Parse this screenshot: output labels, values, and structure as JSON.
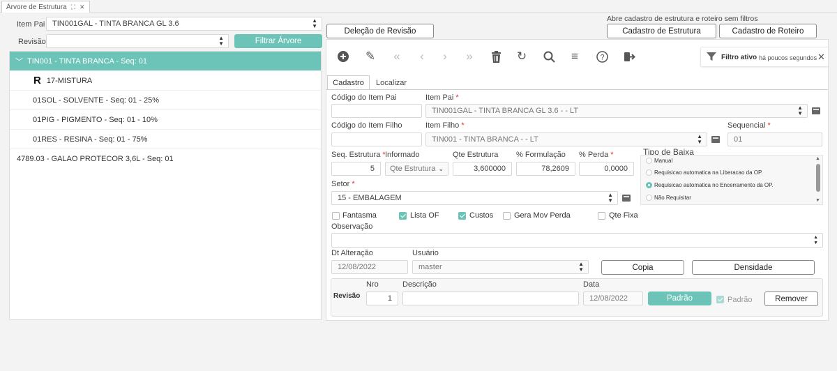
{
  "window": {
    "tab_title": "Árvore de Estrutura"
  },
  "left": {
    "item_pai_label": "Item Pai",
    "item_pai_value": "TIN001GAL - TINTA BRANCA GL 3.6",
    "revisao_label": "Revisão",
    "revisao_value": "",
    "filter_button": "Filtrar Árvore",
    "tree": [
      {
        "label": "TIN001 - TINTA BRANCA - Seq: 01"
      },
      {
        "label": "17-MISTURA"
      },
      {
        "label": "01SOL - SOLVENTE - Seq: 01 - 25%"
      },
      {
        "label": "01PIG - PIGMENTO - Seq: 01 - 10%"
      },
      {
        "label": "01RES - RESINA - Seq: 01 - 75%"
      },
      {
        "label": "4789.03 - GALAO PROTECOR 3,6L - Seq: 01"
      }
    ]
  },
  "top_right": {
    "delete_revision": "Deleção de Revisão",
    "hint": "Abre cadastro de estrutura e roteiro sem filtros",
    "cad_estrutura": "Cadastro de Estrutura",
    "cad_roteiro": "Cadastro de Roteiro"
  },
  "filter_badge": {
    "label": "Filtro ativo",
    "time": "há poucos segundos"
  },
  "form_tabs": [
    "Cadastro",
    "Localizar"
  ],
  "form": {
    "cod_item_pai_label": "Código do Item Pai",
    "cod_item_pai": "",
    "item_pai_label": "Item Pai",
    "item_pai": "TIN001GAL - TINTA BRANCA GL 3.6 -  - LT",
    "cod_item_filho_label": "Código do Item Filho",
    "cod_item_filho": "",
    "item_filho_label": "Item Filho",
    "item_filho": "TIN001 - TINTA BRANCA -  - LT",
    "sequencial_label": "Sequencial",
    "sequencial": "01",
    "seq_estrutura_label": "Seq. Estrutura",
    "seq_estrutura": "5",
    "informado_label": "Informado",
    "informado": "Qte Estrutura",
    "qte_estrutura_label": "Qte Estrutura",
    "qte_estrutura": "3,600000",
    "formulacao_label": "% Formulação",
    "formulacao": "78,2609",
    "perda_label": "% Perda",
    "perda": "0,0000",
    "setor_label": "Setor",
    "setor": "15   - EMBALAGEM",
    "tipo_baixa_label": "Tipo de Baixa",
    "tipo_baixa_options": [
      "Manual",
      "Requisicao automatica na Liberacao da OP.",
      "Requisicao automatica no Encerramento da OP.",
      "Não Requisitar"
    ],
    "checkboxes": {
      "fantasma": "Fantasma",
      "lista_of": "Lista OF",
      "custos": "Custos",
      "gera_mov_perda": "Gera Mov Perda",
      "qte_fixa": "Qte Fixa"
    },
    "observacao_label": "Observação",
    "observacao": "",
    "dt_alteracao_label": "Dt Alteração",
    "dt_alteracao": "12/08/2022",
    "usuario_label": "Usuário",
    "usuario": "master",
    "copia_button": "Copia",
    "densidade_button": "Densidade"
  },
  "revisao": {
    "title": "Revisão",
    "nro_label": "Nro",
    "nro": "1",
    "descricao_label": "Descrição",
    "descricao": "",
    "data_label": "Data",
    "data": "12/08/2022",
    "padrao_button": "Padrão",
    "padrao_check_label": "Padrão",
    "remover_button": "Remover"
  },
  "colors": {
    "accent": "#6cc4b8"
  }
}
